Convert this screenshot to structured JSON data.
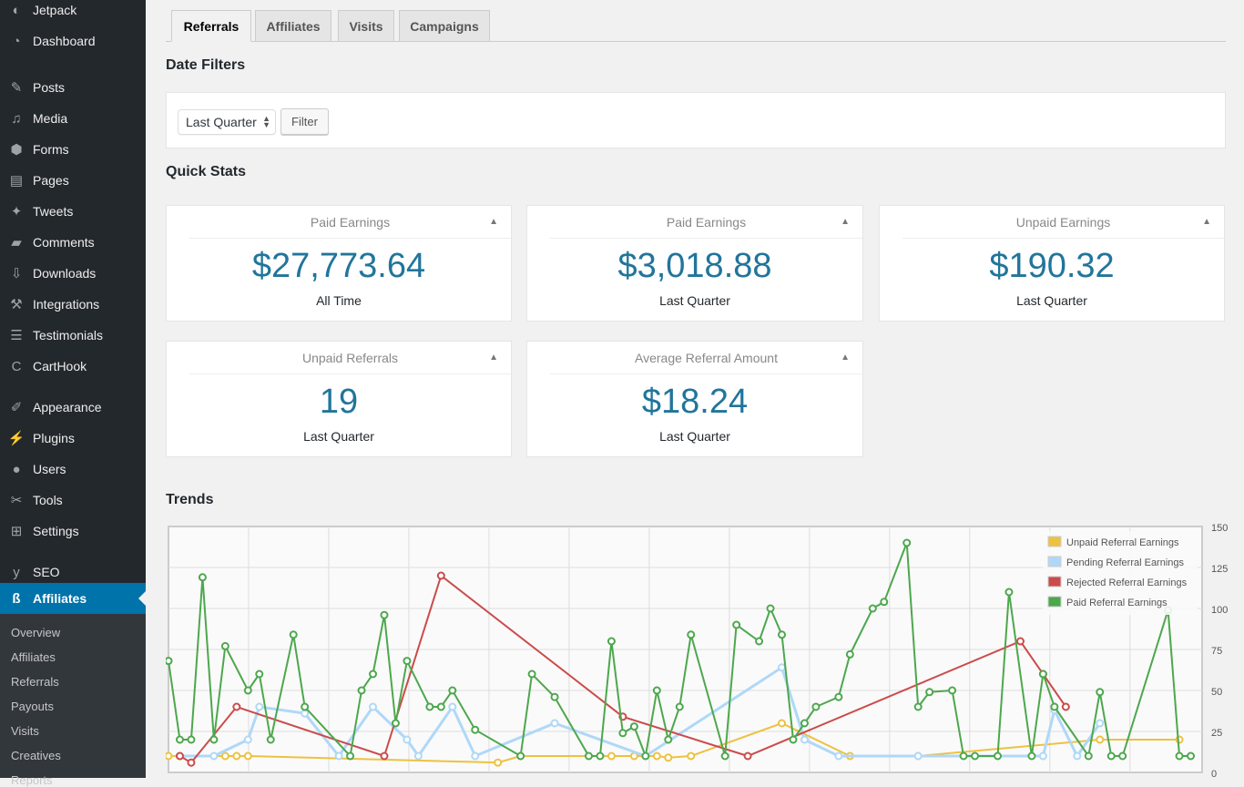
{
  "sidebar": {
    "items": [
      {
        "label": "Jetpack",
        "icon": "jetpack-icon",
        "glyph": "◐"
      },
      {
        "label": "Dashboard",
        "icon": "dashboard-icon",
        "glyph": "◔"
      },
      {
        "label": "Posts",
        "icon": "pin-icon",
        "glyph": "✎"
      },
      {
        "label": "Media",
        "icon": "media-icon",
        "glyph": "♫"
      },
      {
        "label": "Forms",
        "icon": "forms-icon",
        "glyph": "⬢"
      },
      {
        "label": "Pages",
        "icon": "pages-icon",
        "glyph": "▤"
      },
      {
        "label": "Tweets",
        "icon": "twitter-icon",
        "glyph": "✦"
      },
      {
        "label": "Comments",
        "icon": "comment-icon",
        "glyph": "▰"
      },
      {
        "label": "Downloads",
        "icon": "download-icon",
        "glyph": "⇩"
      },
      {
        "label": "Integrations",
        "icon": "hammer-icon",
        "glyph": "⚒"
      },
      {
        "label": "Testimonials",
        "icon": "testimonial-icon",
        "glyph": "☰"
      },
      {
        "label": "CartHook",
        "icon": "carthook-icon",
        "glyph": "C"
      },
      {
        "label": "Appearance",
        "icon": "paintbrush-icon",
        "glyph": "✐"
      },
      {
        "label": "Plugins",
        "icon": "plugin-icon",
        "glyph": "⚡"
      },
      {
        "label": "Users",
        "icon": "user-icon",
        "glyph": "●"
      },
      {
        "label": "Tools",
        "icon": "wrench-icon",
        "glyph": "✂"
      },
      {
        "label": "Settings",
        "icon": "settings-icon",
        "glyph": "⊞"
      },
      {
        "label": "SEO",
        "icon": "yoast-icon",
        "glyph": "y"
      },
      {
        "label": "Affiliates",
        "icon": "affiliates-icon",
        "glyph": "ß"
      }
    ],
    "submenu": [
      "Overview",
      "Affiliates",
      "Referrals",
      "Payouts",
      "Visits",
      "Creatives",
      "Reports"
    ]
  },
  "tabs": [
    "Referrals",
    "Affiliates",
    "Visits",
    "Campaigns"
  ],
  "date_filters": {
    "heading": "Date Filters",
    "select_value": "Last Quarter",
    "filter_button": "Filter"
  },
  "quick_stats": {
    "heading": "Quick Stats",
    "cards": [
      {
        "title": "Paid Earnings",
        "value": "$27,773.64",
        "period": "All Time"
      },
      {
        "title": "Paid Earnings",
        "value": "$3,018.88",
        "period": "Last Quarter"
      },
      {
        "title": "Unpaid Earnings",
        "value": "$190.32",
        "period": "Last Quarter"
      },
      {
        "title": "Unpaid Referrals",
        "value": "19",
        "period": "Last Quarter"
      },
      {
        "title": "Average Referral Amount",
        "value": "$18.24",
        "period": "Last Quarter"
      }
    ],
    "toggle_glyph": "▲"
  },
  "trends": {
    "heading": "Trends"
  },
  "chart_data": {
    "type": "line",
    "title": "Trends",
    "ylim": [
      0,
      150
    ],
    "yticks": [
      0,
      25,
      50,
      75,
      100,
      125,
      150
    ],
    "xrange": [
      0,
      91
    ],
    "grid": true,
    "legend": "top-right",
    "series": [
      {
        "name": "Unpaid Referral Earnings",
        "color": "#edc240",
        "points": [
          [
            0,
            10
          ],
          [
            1,
            10
          ],
          [
            5,
            10
          ],
          [
            6,
            10
          ],
          [
            7,
            10
          ],
          [
            29,
            6
          ],
          [
            31,
            10
          ],
          [
            39,
            10
          ],
          [
            41,
            10
          ],
          [
            43,
            10
          ],
          [
            44,
            9
          ],
          [
            46,
            10
          ],
          [
            54,
            30
          ],
          [
            60,
            10
          ],
          [
            66,
            10
          ],
          [
            82,
            20
          ],
          [
            89,
            20
          ]
        ]
      },
      {
        "name": "Pending Referral Earnings",
        "color": "#afd8f8",
        "points": [
          [
            1,
            10
          ],
          [
            4,
            10
          ],
          [
            7,
            20
          ],
          [
            8,
            40
          ],
          [
            12,
            36
          ],
          [
            15,
            10
          ],
          [
            18,
            40
          ],
          [
            21,
            20
          ],
          [
            22,
            10
          ],
          [
            25,
            40
          ],
          [
            27,
            10
          ],
          [
            34,
            30
          ],
          [
            42,
            10
          ],
          [
            54,
            64
          ],
          [
            56,
            20
          ],
          [
            59,
            10
          ],
          [
            66,
            10
          ],
          [
            77,
            10
          ],
          [
            78,
            38
          ],
          [
            80,
            10
          ],
          [
            82,
            30
          ]
        ]
      },
      {
        "name": "Rejected Referral Earnings",
        "color": "#cb4b4b",
        "points": [
          [
            1,
            10
          ],
          [
            2,
            6
          ],
          [
            6,
            40
          ],
          [
            19,
            10
          ],
          [
            24,
            120
          ],
          [
            40,
            34
          ],
          [
            51,
            10
          ],
          [
            75,
            80
          ],
          [
            77,
            60
          ],
          [
            79,
            40
          ]
        ]
      },
      {
        "name": "Paid Referral Earnings",
        "color": "#4da74d",
        "points": [
          [
            0,
            68
          ],
          [
            1,
            20
          ],
          [
            2,
            20
          ],
          [
            3,
            119
          ],
          [
            4,
            20
          ],
          [
            5,
            77
          ],
          [
            7,
            50
          ],
          [
            8,
            60
          ],
          [
            9,
            20
          ],
          [
            11,
            84
          ],
          [
            12,
            40
          ],
          [
            16,
            10
          ],
          [
            17,
            50
          ],
          [
            18,
            60
          ],
          [
            19,
            96
          ],
          [
            20,
            30
          ],
          [
            21,
            68
          ],
          [
            23,
            40
          ],
          [
            24,
            40
          ],
          [
            25,
            50
          ],
          [
            27,
            26
          ],
          [
            31,
            10
          ],
          [
            32,
            60
          ],
          [
            34,
            46
          ],
          [
            37,
            10
          ],
          [
            38,
            10
          ],
          [
            39,
            80
          ],
          [
            40,
            24
          ],
          [
            41,
            28
          ],
          [
            42,
            10
          ],
          [
            43,
            50
          ],
          [
            44,
            20
          ],
          [
            45,
            40
          ],
          [
            46,
            84
          ],
          [
            49,
            10
          ],
          [
            50,
            90
          ],
          [
            52,
            80
          ],
          [
            53,
            100
          ],
          [
            54,
            84
          ],
          [
            55,
            20
          ],
          [
            56,
            30
          ],
          [
            57,
            40
          ],
          [
            59,
            46
          ],
          [
            60,
            72
          ],
          [
            62,
            100
          ],
          [
            63,
            104
          ],
          [
            65,
            140
          ],
          [
            66,
            40
          ],
          [
            67,
            49
          ],
          [
            69,
            50
          ],
          [
            70,
            10
          ],
          [
            71,
            10
          ],
          [
            73,
            10
          ],
          [
            74,
            110
          ],
          [
            76,
            10
          ],
          [
            77,
            60
          ],
          [
            78,
            40
          ],
          [
            81,
            10
          ],
          [
            82,
            49
          ],
          [
            83,
            10
          ],
          [
            84,
            10
          ],
          [
            88,
            99
          ],
          [
            89,
            10
          ],
          [
            90,
            10
          ]
        ]
      }
    ]
  }
}
